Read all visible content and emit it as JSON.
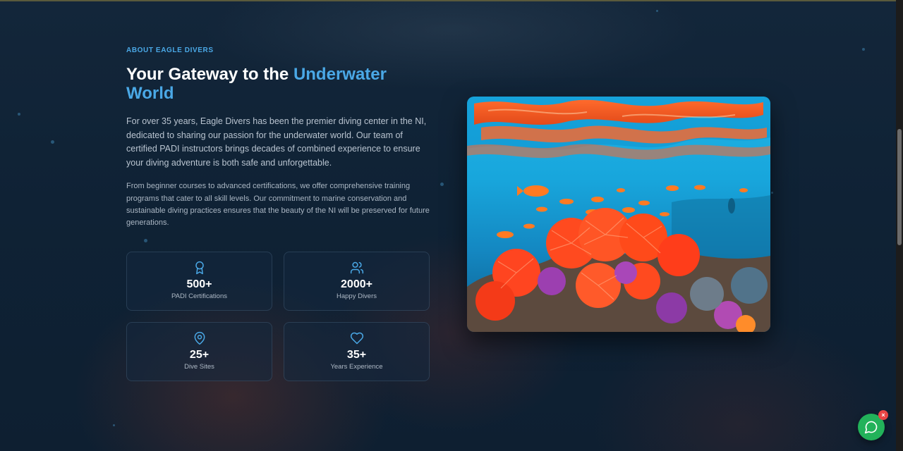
{
  "about": {
    "eyebrow": "ABOUT EAGLE DIVERS",
    "title_plain": "Your Gateway to the ",
    "title_accent": "Underwater World",
    "lead": "For over 35 years, Eagle Divers has been the premier diving center in the NI, dedicated to sharing our passion for the underwater world. Our team of certified PADI instructors brings decades of combined experience to ensure your diving adventure is both safe and unforgettable.",
    "body": "From beginner courses to advanced certifications, we offer comprehensive training programs that cater to all skill levels. Our commitment to marine conservation and sustainable diving practices ensures that the beauty of the NI will be preserved for future generations."
  },
  "stats": [
    {
      "icon": "award-icon",
      "value": "500+",
      "label": "PADI Certifications"
    },
    {
      "icon": "users-icon",
      "value": "2000+",
      "label": "Happy Divers"
    },
    {
      "icon": "map-pin-icon",
      "value": "25+",
      "label": "Dive Sites"
    },
    {
      "icon": "heart-icon",
      "value": "35+",
      "label": "Years Experience"
    }
  ],
  "chat_widget": {
    "close_glyph": "×"
  },
  "colors": {
    "accent": "#4aa8e6",
    "background": "#0d1d2e",
    "chat_green": "#22b25a",
    "close_red": "#e84545"
  }
}
